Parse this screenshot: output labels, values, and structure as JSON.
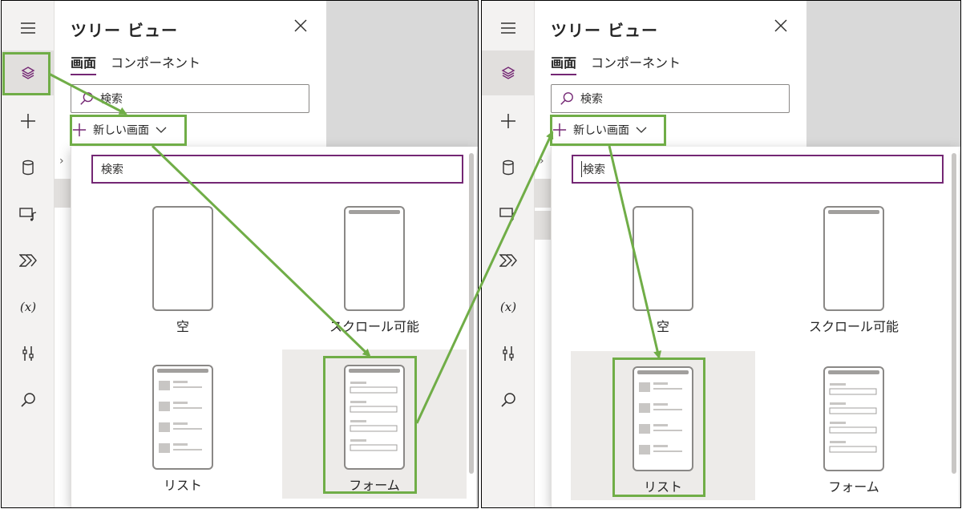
{
  "panel": {
    "title": "ツリー ビュー",
    "tabs": [
      {
        "label": "画面",
        "active": true
      },
      {
        "label": "コンポーネント",
        "active": false
      }
    ],
    "search_placeholder": "検索",
    "new_screen_label": "新しい画面"
  },
  "rail_icons": [
    "hamburger-icon",
    "layers-icon",
    "plus-icon",
    "database-icon",
    "media-icon",
    "power-automate-icon",
    "variables-icon",
    "tools-icon",
    "search-icon"
  ],
  "variables_glyph": "(x)",
  "flyout": {
    "search_placeholder": "検索",
    "templates": [
      {
        "label": "空"
      },
      {
        "label": "スクロール可能"
      },
      {
        "label": "リスト"
      },
      {
        "label": "フォーム"
      }
    ]
  },
  "screenshots": [
    {
      "selected_template": "フォーム"
    },
    {
      "selected_template": "リスト"
    }
  ],
  "colors": {
    "accent": "#742774",
    "highlight": "#70ad47",
    "rail_bg": "#f3f2f1",
    "canvas": "#d9d9d9",
    "selected_tile": "#edebe9"
  }
}
